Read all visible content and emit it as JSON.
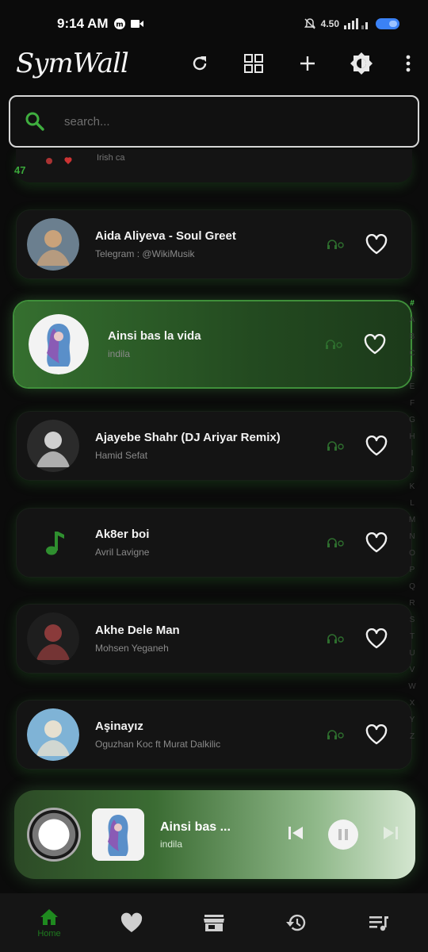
{
  "status": {
    "time": "9:14 AM",
    "network": "4.50"
  },
  "app": {
    "logo": "SymWall"
  },
  "search": {
    "placeholder": "search..."
  },
  "partial": {
    "count": "47",
    "subtitle": "Irish ca"
  },
  "songs": [
    {
      "title": "Aida Aliyeva - Soul Greet",
      "artist": "Telegram : @WikiMusik",
      "thumb": "photo"
    },
    {
      "title": "Ainsi bas la vida",
      "artist": "indila",
      "thumb": "art",
      "active": true
    },
    {
      "title": "Ajayebe Shahr (DJ Ariyar Remix)",
      "artist": "Hamid Sefat",
      "thumb": "photo"
    },
    {
      "title": "Ak8er boi",
      "artist": "Avril Lavigne",
      "thumb": "note"
    },
    {
      "title": "Akhe Dele Man",
      "artist": "Mohsen Yeganeh",
      "thumb": "photo"
    },
    {
      "title": "Aşinayız",
      "artist": "Oguzhan Koc ft Murat Dalkilic",
      "thumb": "photo"
    }
  ],
  "alphabet": [
    "#",
    "A",
    "B",
    "C",
    "D",
    "E",
    "F",
    "G",
    "H",
    "I",
    "J",
    "K",
    "L",
    "M",
    "N",
    "O",
    "P",
    "Q",
    "R",
    "S",
    "T",
    "U",
    "V",
    "W",
    "X",
    "Y",
    "Z"
  ],
  "player": {
    "title": "Ainsi bas ...",
    "artist": "indila"
  },
  "nav": [
    {
      "label": "Home",
      "icon": "home-icon",
      "active": true
    },
    {
      "label": "",
      "icon": "heart-icon"
    },
    {
      "label": "",
      "icon": "store-icon"
    },
    {
      "label": "",
      "icon": "history-icon"
    },
    {
      "label": "",
      "icon": "queue-icon"
    }
  ],
  "colors": {
    "accent": "#3fae3f",
    "active_card": "#356f2f",
    "background": "#0b0b0b"
  }
}
